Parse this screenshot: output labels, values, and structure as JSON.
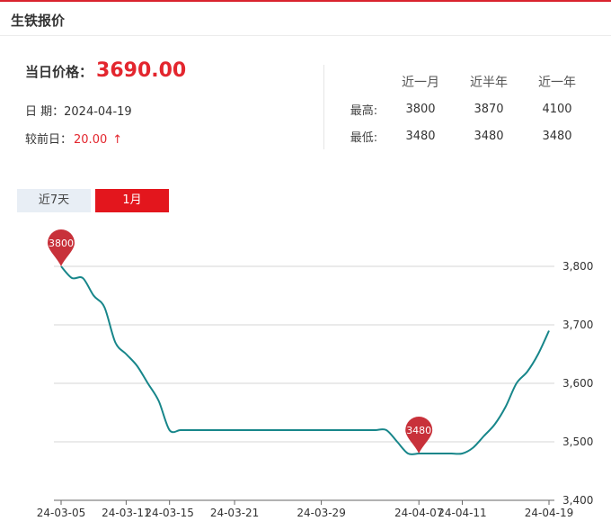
{
  "header": {
    "title": "生铁报价"
  },
  "price": {
    "label": "当日价格：",
    "value": "3690.00"
  },
  "info": {
    "date_label": "日 期：",
    "date_value": "2024-04-19",
    "change_label": "较前日：",
    "change_value": "20.00",
    "change_arrow": "↑"
  },
  "stats": {
    "columns": [
      "近一月",
      "近半年",
      "近一年"
    ],
    "rows": [
      {
        "label": "最高:",
        "values": [
          "3800",
          "3870",
          "4100"
        ]
      },
      {
        "label": "最低:",
        "values": [
          "3480",
          "3480",
          "3480"
        ]
      }
    ]
  },
  "tabs": [
    {
      "label": "近7天",
      "active": false
    },
    {
      "label": "1月",
      "active": true
    }
  ],
  "colors": {
    "accent": "#e3161d",
    "line": "#17868a",
    "marker": "#c8313a",
    "grid": "#d6d6d6"
  },
  "chart_data": {
    "type": "line",
    "x_tick_labels": [
      "24-03-05",
      "24-03-11",
      "24-03-15",
      "24-03-21",
      "24-03-29",
      "24-04-07",
      "24-04-11",
      "24-04-19"
    ],
    "y_tick_labels": [
      "3,400",
      "3,500",
      "3,600",
      "3,700",
      "3,800"
    ],
    "ylim": [
      3400,
      3800
    ],
    "series": [
      {
        "x": [
          "24-03-05",
          "24-03-06",
          "24-03-07",
          "24-03-08",
          "24-03-09",
          "24-03-10",
          "24-03-11",
          "24-03-12",
          "24-03-13",
          "24-03-14",
          "24-03-15",
          "24-03-16",
          "24-03-17",
          "24-03-18",
          "24-03-19",
          "24-03-20",
          "24-03-21",
          "24-03-22",
          "24-03-23",
          "24-03-24",
          "24-03-25",
          "24-03-26",
          "24-03-27",
          "24-03-28",
          "24-03-29",
          "24-03-30",
          "24-03-31",
          "24-04-01",
          "24-04-02",
          "24-04-03",
          "24-04-04",
          "24-04-05",
          "24-04-06",
          "24-04-07",
          "24-04-08",
          "24-04-09",
          "24-04-10",
          "24-04-11",
          "24-04-12",
          "24-04-13",
          "24-04-14",
          "24-04-15",
          "24-04-16",
          "24-04-17",
          "24-04-18",
          "24-04-19"
        ],
        "values": [
          3800,
          3780,
          3780,
          3750,
          3730,
          3670,
          3650,
          3630,
          3600,
          3570,
          3520,
          3520,
          3520,
          3520,
          3520,
          3520,
          3520,
          3520,
          3520,
          3520,
          3520,
          3520,
          3520,
          3520,
          3520,
          3520,
          3520,
          3520,
          3520,
          3520,
          3520,
          3500,
          3480,
          3480,
          3480,
          3480,
          3480,
          3480,
          3490,
          3510,
          3530,
          3560,
          3600,
          3620,
          3650,
          3690
        ]
      }
    ],
    "annotations": [
      {
        "x": "24-03-05",
        "value": 3800,
        "label": "3800"
      },
      {
        "x": "24-04-07",
        "value": 3480,
        "label": "3480"
      }
    ],
    "grid": "horizontal"
  }
}
